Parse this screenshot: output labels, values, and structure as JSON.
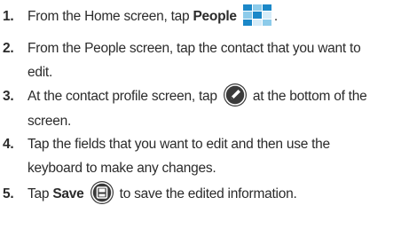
{
  "steps": [
    {
      "number": "1.",
      "pre": "From the Home screen, tap ",
      "bold": "People",
      "icon": "people-app-icon",
      "post": "."
    },
    {
      "number": "2.",
      "line1": "From the People screen, tap the contact that you want to",
      "line2": "edit."
    },
    {
      "number": "3.",
      "pre": "At the contact profile screen, tap ",
      "icon": "edit-pencil-icon",
      "post": " at the bottom of the",
      "line2": "screen."
    },
    {
      "number": "4.",
      "line1": "Tap the fields that you want to edit and then use the",
      "line2": "keyboard to make any changes."
    },
    {
      "number": "5.",
      "pre": "Tap ",
      "bold": "Save",
      "icon": "save-disk-icon",
      "post": " to save the edited information."
    }
  ],
  "colors": {
    "text": "#2b2b2b",
    "icon_dark": "#3a3a3a",
    "people_blue_dark": "#1b88c8",
    "people_blue_light": "#8ccbea"
  }
}
